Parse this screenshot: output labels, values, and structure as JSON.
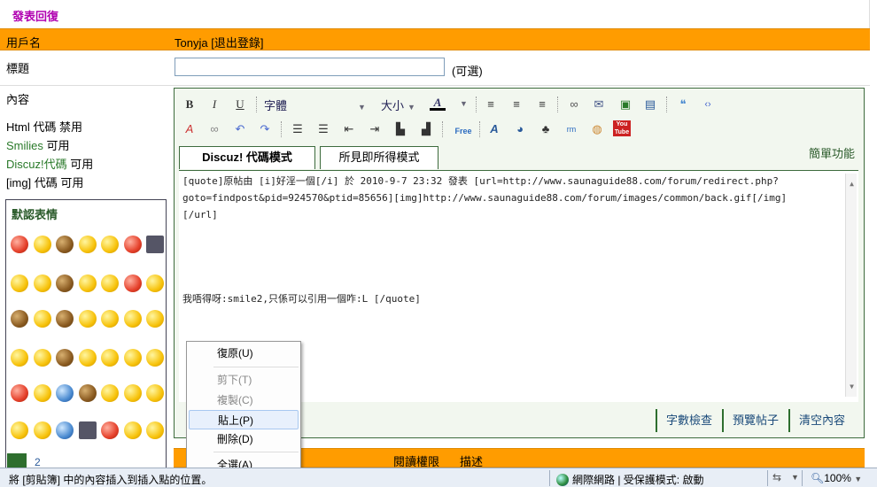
{
  "page": {
    "title": "發表回復"
  },
  "user": {
    "label": "用戶名",
    "name": "Tonyja",
    "logout": "[退出登錄]"
  },
  "subject": {
    "label": "標題",
    "value": "",
    "optional": "(可選)"
  },
  "content_label": "內容",
  "permissions": [
    {
      "prefix": "Html 代碼 ",
      "status": "禁用",
      "green": false
    },
    {
      "prefix": "Smilies",
      "status": " 可用",
      "green": true
    },
    {
      "prefix": "Discuz!代碼",
      "status": " 可用",
      "green": true
    },
    {
      "prefix": "[img] 代碼 ",
      "status": "可用",
      "green": false
    }
  ],
  "smilies": {
    "title": "默認表情",
    "page": "2"
  },
  "toolbar": {
    "bold": "B",
    "italic": "I",
    "underline": "U",
    "font": "字體",
    "size": "大小",
    "color": "A",
    "free": "Free",
    "youtube": "You Tube"
  },
  "tabs": {
    "discuz": "Discuz! 代碼模式",
    "wysiwyg": "所見即所得模式"
  },
  "simple_mode": "簡單功能",
  "editor_text": [
    "[quote]原帖由 [i]好淫一個[/i] 於 2010-9-7 23:32 發表 [url=http://www.saunaguide88.com/forum/redirect.php?",
    "goto=findpost&pid=924570&ptid=85656][img]http://www.saunaguide88.com/forum/images/common/back.gif[/img]",
    "[/url]",
    "",
    "",
    "",
    "",
    "我唔得呀:smile2,只係可以引用一個咋:L [/quote]"
  ],
  "footer_buttons": {
    "count": "字數檢查",
    "preview": "預覽帖子",
    "clear": "清空內容"
  },
  "bottom_row": {
    "col1": "閱讀權限",
    "col2": "描述"
  },
  "context_menu": {
    "undo": "復原(U)",
    "cut": "剪下(T)",
    "copy": "複製(C)",
    "paste": "貼上(P)",
    "delete": "刪除(D)",
    "select_all": "全選(A)"
  },
  "status_bar": {
    "message": "將 [剪貼簿] 中的內容插入到插入點的位置。",
    "zone": "網際網路 | 受保護模式: 啟動",
    "zoom": "100%"
  }
}
